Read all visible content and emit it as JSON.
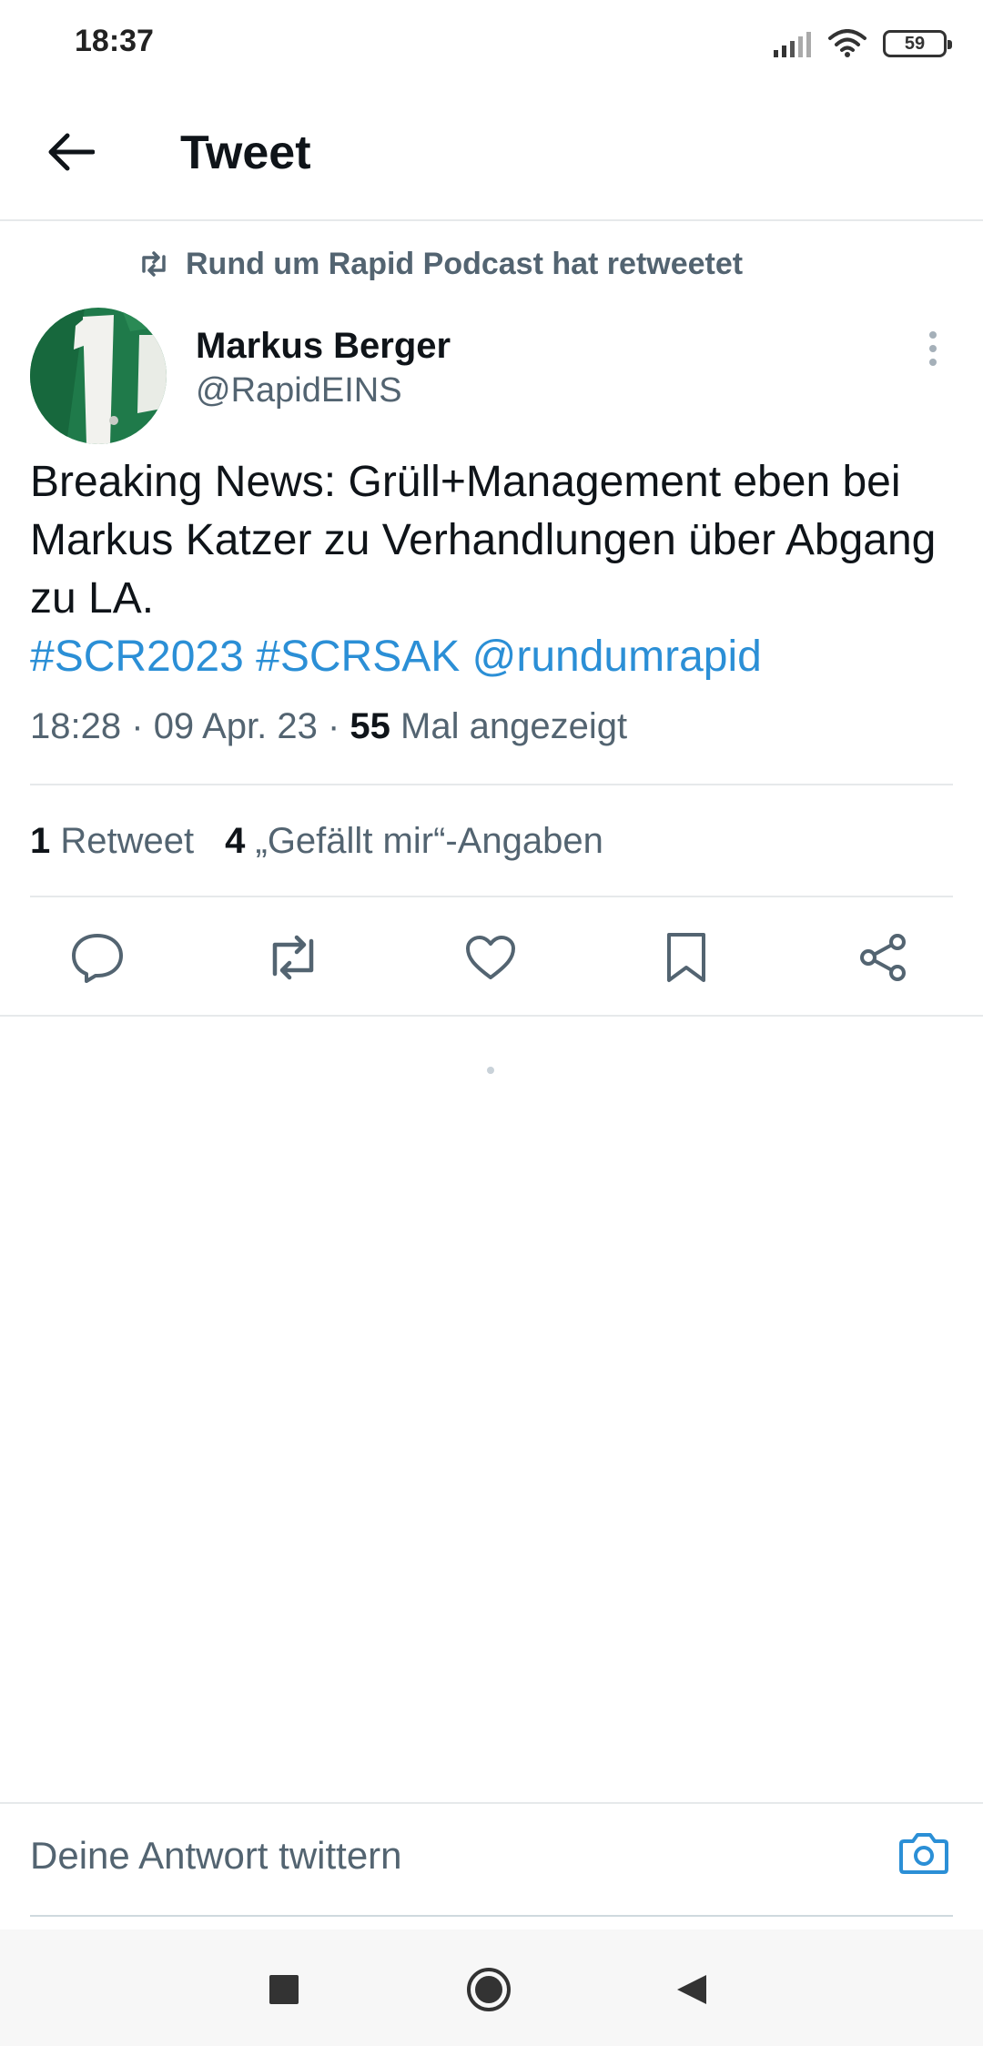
{
  "status_bar": {
    "time": "18:37",
    "battery_level": "59",
    "icons": [
      "signal-icon",
      "wifi-icon",
      "battery-icon"
    ]
  },
  "header": {
    "title": "Tweet",
    "back_icon": "arrow-left-icon"
  },
  "tweet": {
    "retweet_context": "Rund um Rapid Podcast hat retweetet",
    "author_name": "Markus Berger",
    "author_handle": "@RapidEINS",
    "text": "Breaking News: Grüll+Management eben bei Markus Katzer zu Verhandlungen über Abgang zu LA.",
    "hashtag_1": "#SCR2023",
    "hashtag_2": "#SCRSAK",
    "mention": "@rundumrapid",
    "time": "18:28",
    "date": "09 Apr. 23",
    "separator": "·",
    "views_count": "55",
    "views_label": "Mal angezeigt"
  },
  "stats": {
    "retweet_count": "1",
    "retweet_label": "Retweet",
    "likes_count": "4",
    "likes_label": "„Gefällt mir“-Angaben"
  },
  "actions": [
    "reply-icon",
    "retweet-icon",
    "like-icon",
    "bookmark-icon",
    "share-icon"
  ],
  "reply": {
    "placeholder": "Deine Antwort twittern",
    "camera_icon": "camera-icon"
  },
  "colors": {
    "accent": "#2b8fd6",
    "secondary_text": "#536471",
    "primary_text": "#0f1419",
    "avatar_green": "#1f7a4a"
  }
}
